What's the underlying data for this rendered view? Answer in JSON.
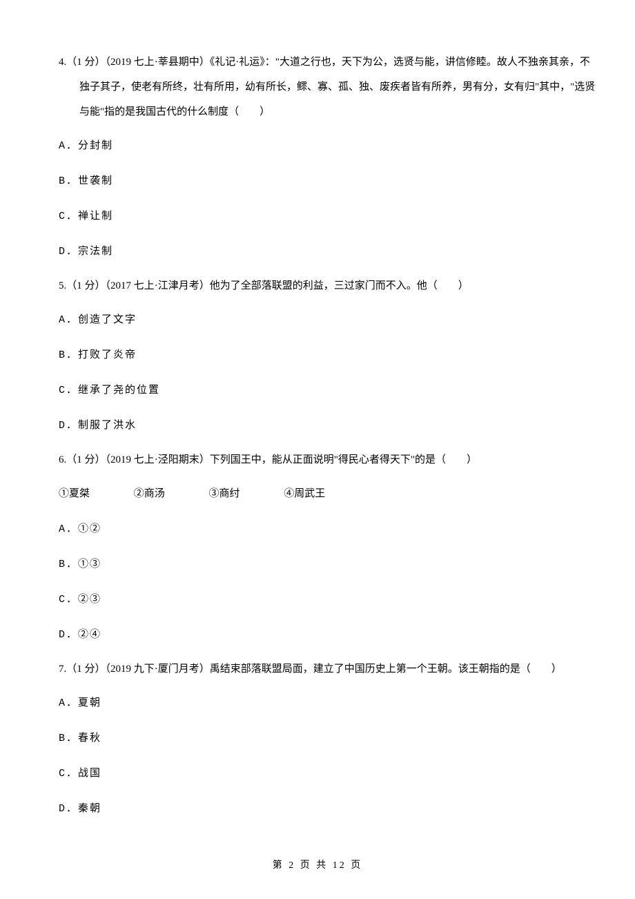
{
  "q4": {
    "stem": "4.（1 分）（2019 七上·莘县期中）《礼记·礼运》：\"大道之行也，天下为公，选贤与能，讲信修睦。故人不独亲其亲，不独子其子，使老有所终，壮有所用，幼有所长，鳏、寡、孤、独、废疾者皆有所养，男有分，女有归\"其中，\"选贤与能\"指的是我国古代的什么制度（　　）",
    "a": "A．分封制",
    "b": "B．世袭制",
    "c": "C．禅让制",
    "d": "D．宗法制"
  },
  "q5": {
    "stem": "5.（1 分）（2017 七上·江津月考）他为了全部落联盟的利益，三过家门而不入。他（　　）",
    "a": "A．创造了文字",
    "b": "B．打败了炎帝",
    "c": "C．继承了尧的位置",
    "d": "D．制服了洪水"
  },
  "q6": {
    "stem": "6.（1 分）（2019 七上·泾阳期末）下列国王中，能从正面说明\"得民心者得天下\"的是（　　）",
    "list1": "①夏桀",
    "list2": "②商汤",
    "list3": "③商纣",
    "list4": "④周武王",
    "a": "A．①②",
    "b": "B．①③",
    "c": "C．②③",
    "d": "D．②④"
  },
  "q7": {
    "stem": "7.（1 分）（2019 九下·厦门月考）禹结束部落联盟局面，建立了中国历史上第一个王朝。该王朝指的是（　　）",
    "a": "A．夏朝",
    "b": "B．春秋",
    "c": "C．战国",
    "d": "D．秦朝"
  },
  "footer": "第 2 页 共 12 页"
}
